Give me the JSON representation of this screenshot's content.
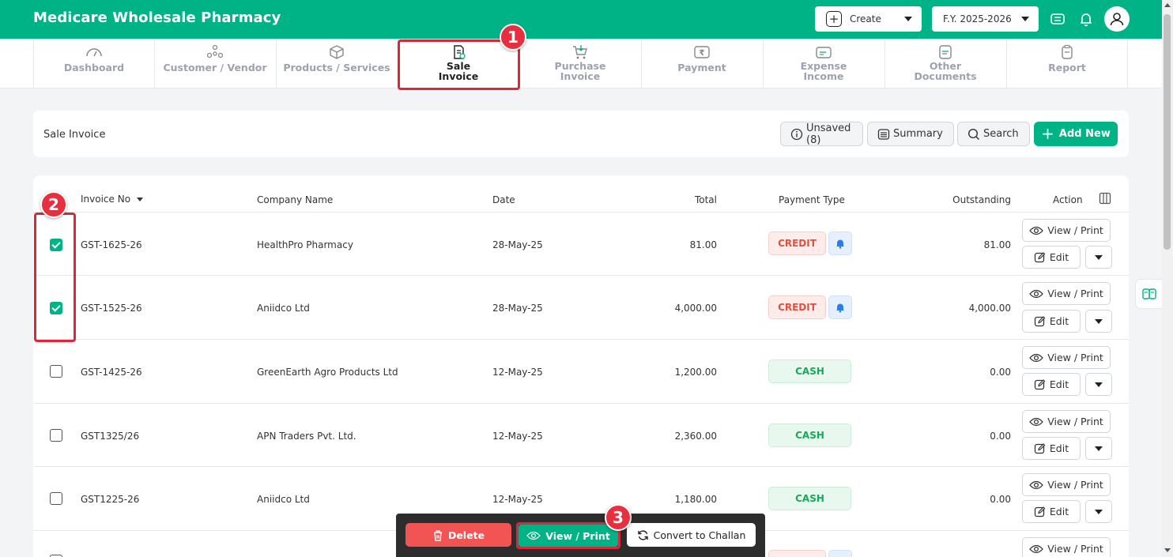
{
  "header": {
    "app_title": "Medicare Wholesale Pharmacy",
    "create_label": "Create",
    "fy_label": "F.Y. 2025-2026",
    "icons": [
      "keyboard-icon",
      "bell-icon",
      "user-avatar-icon"
    ]
  },
  "nav": {
    "items": [
      {
        "label": "Dashboard",
        "icon": "gauge-icon"
      },
      {
        "label": "Customer / Vendor",
        "icon": "people-network-icon"
      },
      {
        "label": "Products / Services",
        "icon": "box-icon"
      },
      {
        "label": "Sale Invoice",
        "icon": "invoice-icon",
        "active": true
      },
      {
        "label": "Purchase Invoice",
        "icon": "cart-icon"
      },
      {
        "label": "Payment",
        "icon": "rupee-icon"
      },
      {
        "label": "Expense Income",
        "icon": "wallet-icon"
      },
      {
        "label": "Other Documents",
        "icon": "document-icon"
      },
      {
        "label": "Report",
        "icon": "clipboard-icon"
      }
    ],
    "labels": {
      "dashboard": "Dashboard",
      "customer": "Customer / Vendor",
      "products": "Products / Services",
      "sale_1": "Sale",
      "sale_2": "Invoice",
      "purchase_1": "Purchase",
      "purchase_2": "Invoice",
      "payment": "Payment",
      "expense_1": "Expense",
      "expense_2": "Income",
      "other_1": "Other",
      "other_2": "Documents",
      "report": "Report"
    }
  },
  "toolbar": {
    "page_title": "Sale Invoice",
    "unsaved_label": "Unsaved (8)",
    "summary_label": "Summary",
    "search_label": "Search",
    "add_new_label": "Add New"
  },
  "table": {
    "columns": {
      "invoice_no": "Invoice No",
      "company": "Company Name",
      "date": "Date",
      "total": "Total",
      "payment_type": "Payment Type",
      "outstanding": "Outstanding",
      "action": "Action"
    },
    "rows": [
      {
        "checked": true,
        "invoice_no": "GST-1625-26",
        "company": "HealthPro Pharmacy",
        "date": "28-May-25",
        "total": "81.00",
        "payment_type": "CREDIT",
        "outstanding": "81.00"
      },
      {
        "checked": true,
        "invoice_no": "GST-1525-26",
        "company": "Aniidco Ltd",
        "date": "28-May-25",
        "total": "4,000.00",
        "payment_type": "CREDIT",
        "outstanding": "4,000.00"
      },
      {
        "checked": false,
        "invoice_no": "GST-1425-26",
        "company": "GreenEarth Agro Products Ltd",
        "date": "12-May-25",
        "total": "1,200.00",
        "payment_type": "CASH",
        "outstanding": "0.00"
      },
      {
        "checked": false,
        "invoice_no": "GST1325/26",
        "company": "APN Traders Pvt. Ltd.",
        "date": "12-May-25",
        "total": "2,360.00",
        "payment_type": "CASH",
        "outstanding": "0.00"
      },
      {
        "checked": false,
        "invoice_no": "GST1225-26",
        "company": "Aniidco Ltd",
        "date": "12-May-25",
        "total": "1,180.00",
        "payment_type": "CASH",
        "outstanding": "0.00"
      }
    ],
    "view_print_label": "View / Print",
    "edit_label": "Edit"
  },
  "bulk_bar": {
    "delete_label": "Delete",
    "view_print_label": "View / Print",
    "convert_label": "Convert to Challan"
  },
  "annotations": {
    "step1": "1",
    "step2": "2",
    "step3": "3"
  },
  "colors": {
    "brand": "#00b386",
    "annotation": "#dc2639",
    "credit": "#e34f3f",
    "cash": "#1aa85a",
    "delete": "#f25454"
  }
}
